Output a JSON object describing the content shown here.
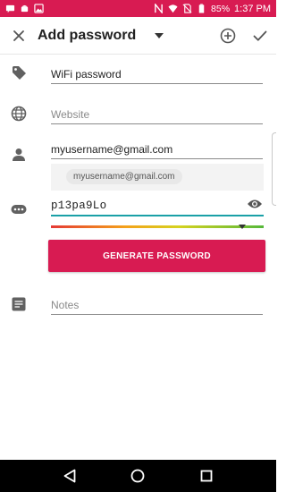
{
  "status_bar": {
    "battery": "85%",
    "time": "1:37 PM"
  },
  "app_bar": {
    "title": "Add password"
  },
  "form": {
    "title_value": "WiFi password",
    "website_placeholder": "Website",
    "username_value": "myusername@gmail.com",
    "username_suggestion": "myusername@gmail.com",
    "password_value": "p13pa9Lo",
    "generate_label": "GENERATE PASSWORD",
    "notes_placeholder": "Notes",
    "strength_level": 0.9
  },
  "icons": {
    "close": "close-icon",
    "dropdown": "caret-down-icon",
    "add": "add-circle-icon",
    "confirm": "check-icon",
    "tag": "tag-icon",
    "website": "globe-icon",
    "username": "person-icon",
    "password": "password-dots-icon",
    "eye": "eye-icon",
    "notes": "notes-icon"
  },
  "colors": {
    "accent": "#d81b52",
    "focus": "#1aa0a7"
  }
}
